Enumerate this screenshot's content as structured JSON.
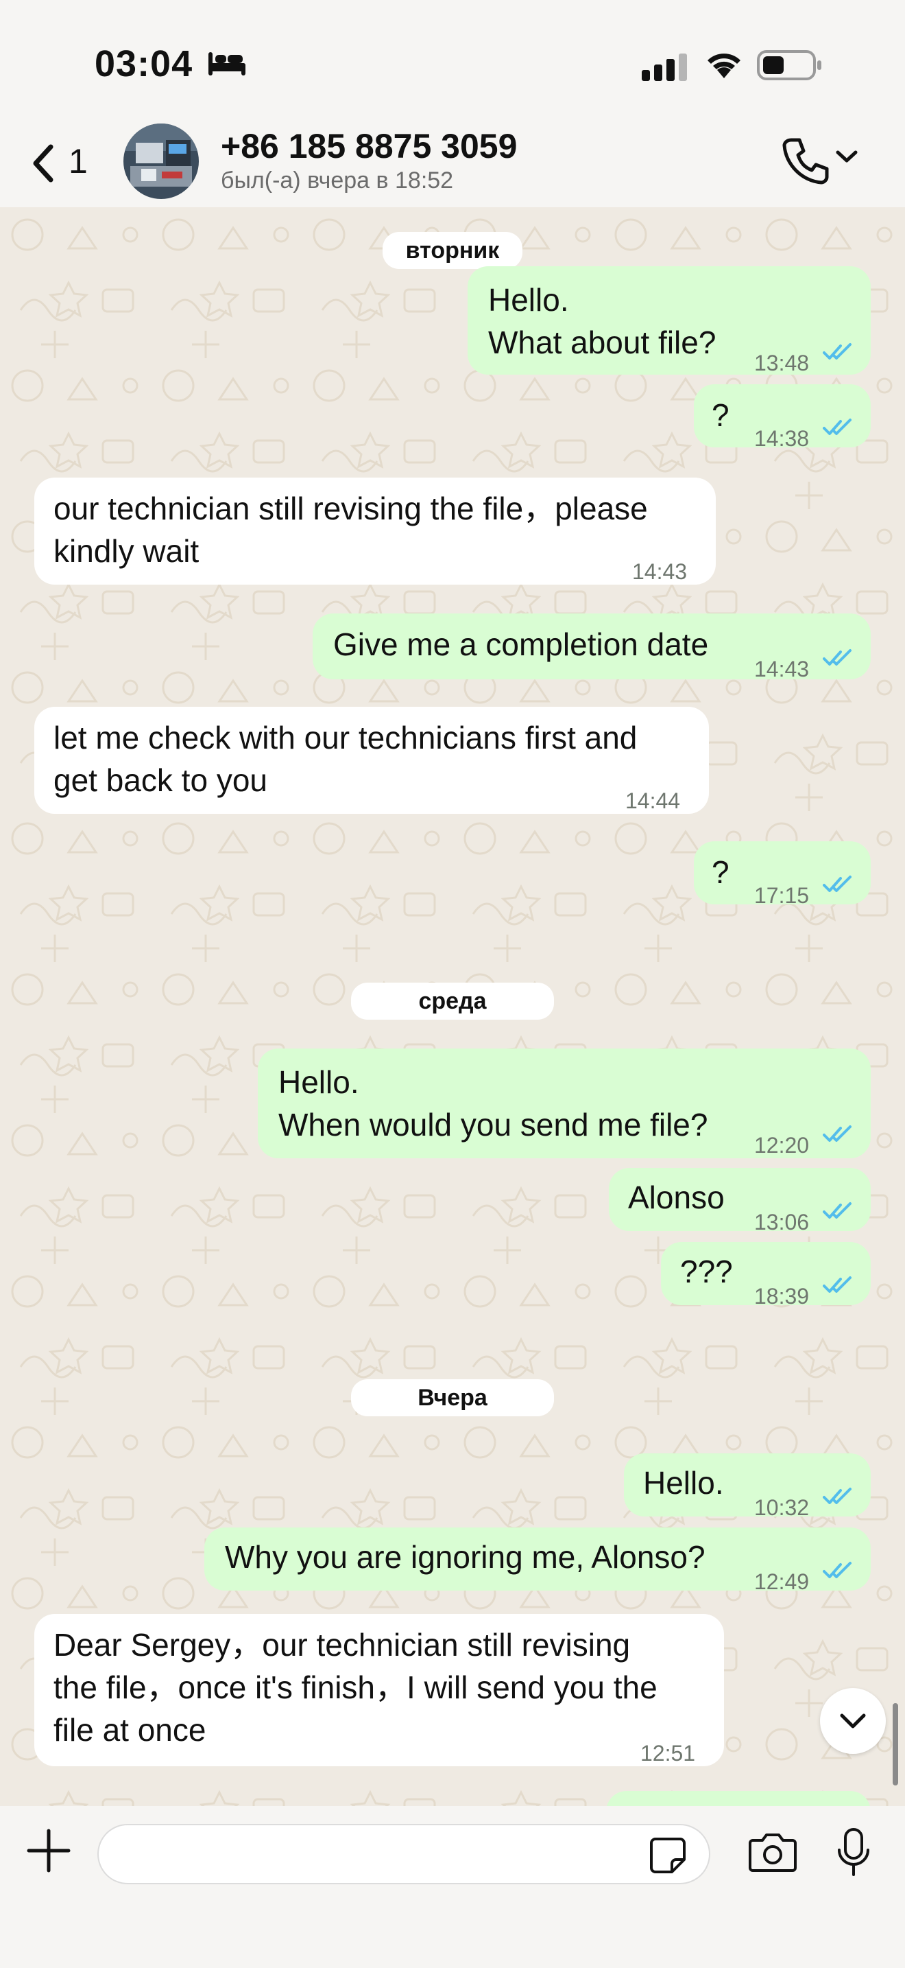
{
  "status_bar": {
    "time": "03:04"
  },
  "header": {
    "back_count": "1",
    "contact_name": "+86 185 8875 3059",
    "contact_status": "был(-а) вчера в 18:52"
  },
  "chat": {
    "days": [
      "вторник",
      "среда",
      "Вчера"
    ],
    "messages": [
      {
        "dir": "out",
        "text": "Hello.\nWhat about file?",
        "time": "13:48"
      },
      {
        "dir": "out",
        "text": "?",
        "time": "14:38"
      },
      {
        "dir": "in",
        "text": "our technician still revising the file，please\nkindly wait",
        "time": "14:43"
      },
      {
        "dir": "out",
        "text": "Give me a completion date",
        "time": "14:43"
      },
      {
        "dir": "in",
        "text": "let me check with our technicians first and\nget back to you",
        "time": "14:44"
      },
      {
        "dir": "out",
        "text": "?",
        "time": "17:15"
      },
      {
        "dir": "out",
        "text": "Hello.\nWhen would you send me file?",
        "time": "12:20"
      },
      {
        "dir": "out",
        "text": "Alonso",
        "time": "13:06"
      },
      {
        "dir": "out",
        "text": "???",
        "time": "18:39"
      },
      {
        "dir": "out",
        "text": "Hello.",
        "time": "10:32"
      },
      {
        "dir": "out",
        "text": "Why you are ignoring me, Alonso?",
        "time": "12:49"
      },
      {
        "dir": "in",
        "text": "Dear Sergey，our technician still revising\nthe file，once it's finish，I will send you the\nfile at once",
        "time": "12:51"
      }
    ]
  },
  "colors": {
    "outgoing_bubble": "#D9FDD3",
    "incoming_bubble": "#FFFFFF",
    "read_ticks": "#53BDEB",
    "wallpaper": "#EFEAE2"
  },
  "icons": [
    "bed-icon",
    "signal-icon",
    "wifi-icon",
    "battery-icon",
    "back-chevron-icon",
    "phone-icon",
    "chevron-down-icon",
    "plus-icon",
    "sticker-icon",
    "camera-icon",
    "microphone-icon",
    "scroll-down-icon"
  ]
}
